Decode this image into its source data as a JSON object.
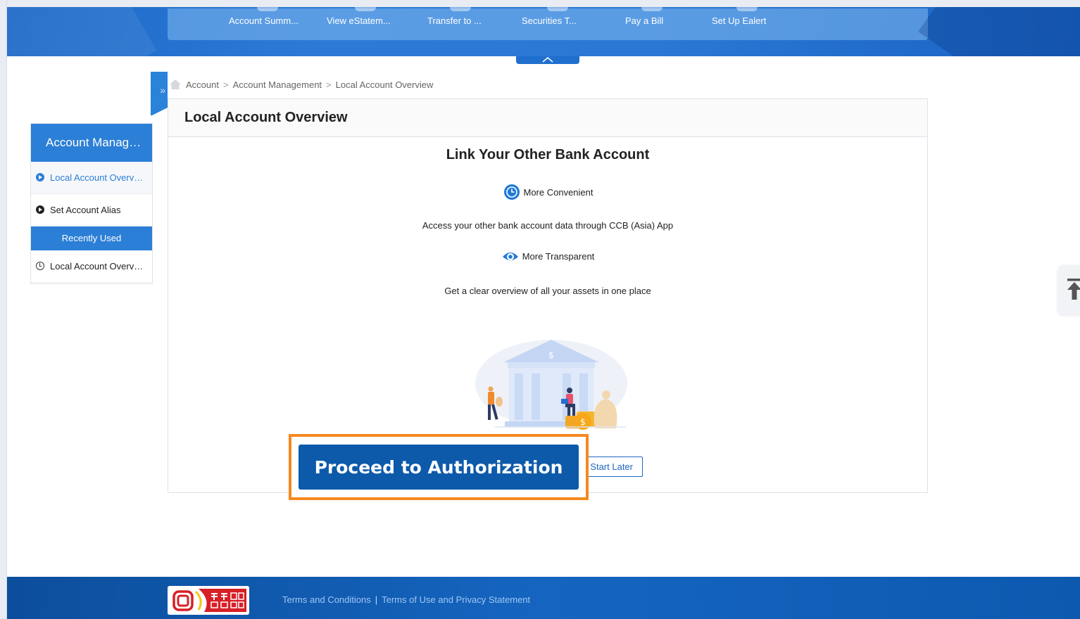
{
  "quicknav": [
    {
      "label": "Account Summ..."
    },
    {
      "label": "View eStatem..."
    },
    {
      "label": "Transfer to ..."
    },
    {
      "label": "Securities T..."
    },
    {
      "label": "Pay a Bill"
    },
    {
      "label": "Set Up Ealert"
    }
  ],
  "breadcrumb": {
    "items": [
      "Account",
      "Account Management",
      "Local Account Overview"
    ],
    "separator": ">"
  },
  "sidebar": {
    "title": "Account Manag…",
    "items": [
      {
        "label": "Local Account Overv…",
        "active": true
      },
      {
        "label": "Set Account Alias",
        "active": false
      }
    ],
    "recent_header": "Recently Used",
    "recent_items": [
      {
        "label": "Local Account Overv…"
      }
    ]
  },
  "main": {
    "title": "Local Account Overview",
    "link_title": "Link Your Other Bank Account",
    "features": [
      {
        "icon": "clock-icon",
        "label": "More Convenient",
        "desc": "Access your other bank account data through CCB (Asia) App"
      },
      {
        "icon": "eye-icon",
        "label": "More Transparent",
        "desc": "Get a clear overview of all your assets in one place"
      }
    ],
    "proceed_label": "Proceed to Authorization",
    "later_label": "Start Later"
  },
  "footer": {
    "links": [
      "Terms and Conditions",
      "Terms of Use and Privacy Statement"
    ],
    "separator": "|"
  },
  "colors": {
    "brand_blue": "#2b7fd6",
    "button_blue": "#0d5aab",
    "highlight_orange": "#f5891f"
  }
}
